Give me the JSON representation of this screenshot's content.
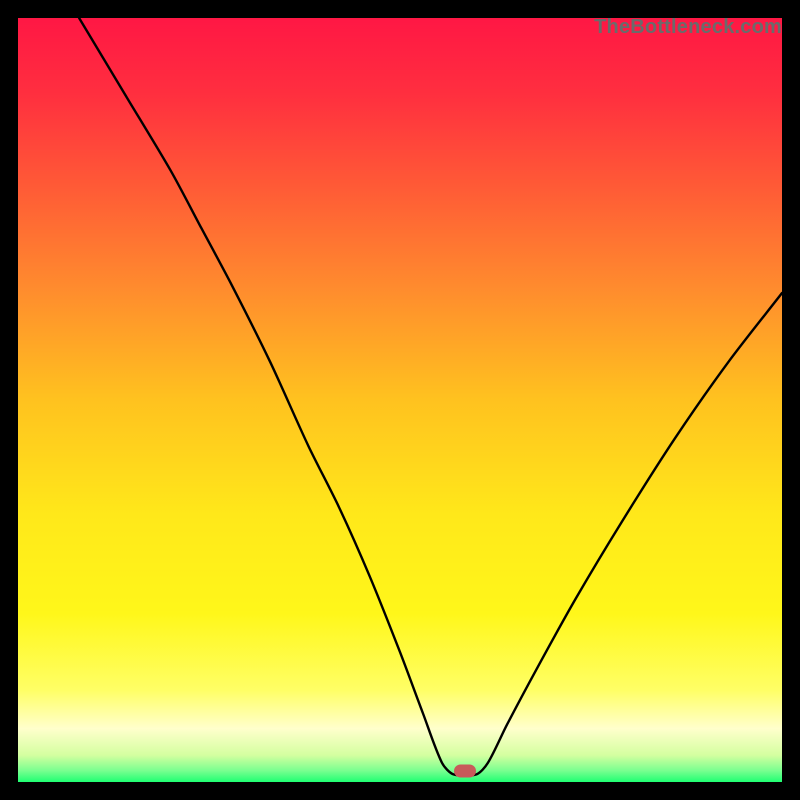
{
  "attribution": "TheBottleneck.com",
  "colors": {
    "background": "#000000",
    "line": "#000000",
    "marker": "#c85a5a",
    "gradient_stops": [
      {
        "offset": 0.0,
        "color": "#ff1744"
      },
      {
        "offset": 0.1,
        "color": "#ff2f3f"
      },
      {
        "offset": 0.22,
        "color": "#ff5a36"
      },
      {
        "offset": 0.35,
        "color": "#ff8a2e"
      },
      {
        "offset": 0.5,
        "color": "#ffc21f"
      },
      {
        "offset": 0.65,
        "color": "#ffe81a"
      },
      {
        "offset": 0.78,
        "color": "#fff71a"
      },
      {
        "offset": 0.88,
        "color": "#ffff66"
      },
      {
        "offset": 0.93,
        "color": "#ffffcc"
      },
      {
        "offset": 0.965,
        "color": "#d4ffa0"
      },
      {
        "offset": 0.985,
        "color": "#7aff90"
      },
      {
        "offset": 1.0,
        "color": "#1fff72"
      }
    ]
  },
  "chart_data": {
    "type": "line",
    "title": "",
    "xlabel": "",
    "ylabel": "",
    "x_range": [
      0,
      100
    ],
    "y_range": [
      0,
      100
    ],
    "note": "V-shaped bottleneck curve; low y = better (green). Marker sits at the minimum.",
    "marker": {
      "x": 58.5,
      "y": 1.5
    },
    "series": [
      {
        "name": "bottleneck-curve",
        "points": [
          {
            "x": 8.0,
            "y": 100.0
          },
          {
            "x": 14.0,
            "y": 90.0
          },
          {
            "x": 20.0,
            "y": 80.0
          },
          {
            "x": 24.0,
            "y": 72.5
          },
          {
            "x": 28.0,
            "y": 65.0
          },
          {
            "x": 33.0,
            "y": 55.0
          },
          {
            "x": 38.0,
            "y": 44.0
          },
          {
            "x": 42.0,
            "y": 36.0
          },
          {
            "x": 46.0,
            "y": 27.0
          },
          {
            "x": 50.0,
            "y": 17.0
          },
          {
            "x": 53.0,
            "y": 9.0
          },
          {
            "x": 55.5,
            "y": 2.5
          },
          {
            "x": 57.0,
            "y": 1.0
          },
          {
            "x": 60.0,
            "y": 1.0
          },
          {
            "x": 61.5,
            "y": 2.5
          },
          {
            "x": 64.0,
            "y": 7.5
          },
          {
            "x": 68.0,
            "y": 15.0
          },
          {
            "x": 73.0,
            "y": 24.0
          },
          {
            "x": 79.0,
            "y": 34.0
          },
          {
            "x": 86.0,
            "y": 45.0
          },
          {
            "x": 93.0,
            "y": 55.0
          },
          {
            "x": 100.0,
            "y": 64.0
          }
        ]
      }
    ]
  }
}
